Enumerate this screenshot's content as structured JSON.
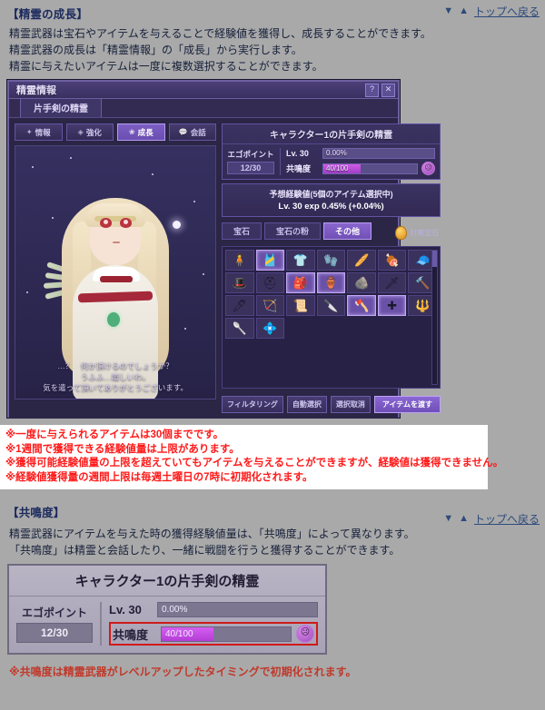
{
  "sections": [
    {
      "title": "【精霊の成長】",
      "nav": {
        "down": "▼",
        "up": "▲",
        "top_link": "トップへ戻る"
      },
      "paragraphs": [
        "精霊武器は宝石やアイテムを与えることで経験値を獲得し、成長することができます。",
        "精霊武器の成長は「精霊情報」の「成長」から実行します。",
        "精霊に与えたいアイテムは一度に複数選択することができます。"
      ]
    },
    {
      "title": "【共鳴度】",
      "nav": {
        "down": "▼",
        "up": "▲",
        "top_link": "トップへ戻る"
      },
      "paragraphs": [
        "精霊武器にアイテムを与えた時の獲得経験値量は、「共鳴度」によって異なります。",
        "「共鳴度」は精霊と会話したり、一緒に戦闘を行うと獲得することができます。"
      ]
    }
  ],
  "game_window": {
    "title": "精霊情報",
    "help_button": "?",
    "close_button": "✕",
    "tab": "片手剣の精霊",
    "modes": [
      {
        "label": "情報",
        "icon": "info-icon",
        "glyph": "✦",
        "active": false
      },
      {
        "label": "強化",
        "icon": "enhance-icon",
        "glyph": "◈",
        "active": false
      },
      {
        "label": "成長",
        "icon": "growth-icon",
        "glyph": "❀",
        "active": true
      },
      {
        "label": "会話",
        "icon": "talk-icon",
        "glyph": "💬",
        "active": false
      }
    ],
    "dialog_lines": [
      "…？　何か頂けるのでしょうか？",
      "うふふ…嬉しいわ。",
      "気を遣って頂いてありがとうございます。"
    ],
    "status_card": {
      "title": "キャラクター1の片手剣の精霊",
      "ego_label": "エゴポイント",
      "ego_value": "12/30",
      "level_label": "Lv. 30",
      "level_value": "0.00%",
      "level_percent": 0,
      "resonance_label": "共鳴度",
      "resonance_value": "40/100",
      "resonance_percent": 40,
      "face_icon": "sad-face-icon"
    },
    "exp_card": {
      "line1": "予想経験値(5個のアイテム選択中)",
      "line2": "Lv. 30 exp 0.45% (+0.04%)"
    },
    "item_tabs": [
      {
        "label": "宝石",
        "active": false
      },
      {
        "label": "宝石の粉",
        "active": false
      },
      {
        "label": "その他",
        "active": true
      }
    ],
    "currency": {
      "icon": "gem-coin-icon",
      "label": "封魔宝石"
    },
    "item_slots": [
      {
        "glyph": "🧍",
        "selected": false
      },
      {
        "glyph": "🎽",
        "selected": true
      },
      {
        "glyph": "👕",
        "selected": false
      },
      {
        "glyph": "🧤",
        "selected": false
      },
      {
        "glyph": "🥖",
        "selected": false
      },
      {
        "glyph": "🍖",
        "selected": false
      },
      {
        "glyph": "🧢",
        "selected": false
      },
      {
        "glyph": "🎩",
        "selected": false
      },
      {
        "glyph": "⛑",
        "selected": false
      },
      {
        "glyph": "🎒",
        "selected": true
      },
      {
        "glyph": "🏺",
        "selected": true
      },
      {
        "glyph": "🪨",
        "selected": false
      },
      {
        "glyph": "🗡",
        "selected": false
      },
      {
        "glyph": "🔨",
        "selected": false
      },
      {
        "glyph": "🖊",
        "selected": false
      },
      {
        "glyph": "🏹",
        "selected": false
      },
      {
        "glyph": "📜",
        "selected": false
      },
      {
        "glyph": "🔪",
        "selected": false
      },
      {
        "glyph": "🪓",
        "selected": true
      },
      {
        "glyph": "✚",
        "selected": true
      },
      {
        "glyph": "🔱",
        "selected": false
      },
      {
        "glyph": "🥄",
        "selected": false
      },
      {
        "glyph": "💠",
        "selected": false
      }
    ],
    "actions": [
      {
        "label": "フィルタリング",
        "primary": false
      },
      {
        "label": "自動選択",
        "primary": false
      },
      {
        "label": "選択取消",
        "primary": false
      },
      {
        "label": "アイテムを渡す",
        "primary": true
      }
    ]
  },
  "notice": {
    "lines": [
      "※一度に与えられるアイテムは30個までです。",
      "※1週間で獲得できる経験値量は上限があります。",
      "※獲得可能経験値量の上限を超えていてもアイテムを与えることができますが、経験値は獲得できません。",
      "※経験値獲得量の週間上限は毎週土曜日の7時に初期化されます。"
    ]
  },
  "bottom_panel": {
    "title": "キャラクター1の片手剣の精霊",
    "ego_label": "エゴポイント",
    "ego_value": "12/30",
    "level_label": "Lv. 30",
    "level_value": "0.00%",
    "level_percent": 0,
    "resonance_label": "共鳴度",
    "resonance_value": "40/100",
    "resonance_percent": 40,
    "face_icon": "sad-face-icon"
  },
  "footer_note": "※共鳴度は精霊武器がレベルアップしたタイミングで初期化されます。",
  "colors": {
    "page_bg": "#a9a9a9",
    "heading": "#1b2a5e",
    "link": "#2d4a7a",
    "notice_red": "#ff1a1a",
    "footer_red": "#c0392b",
    "highlight_border": "#d01a1a",
    "accent_purple": "#7150b6"
  }
}
